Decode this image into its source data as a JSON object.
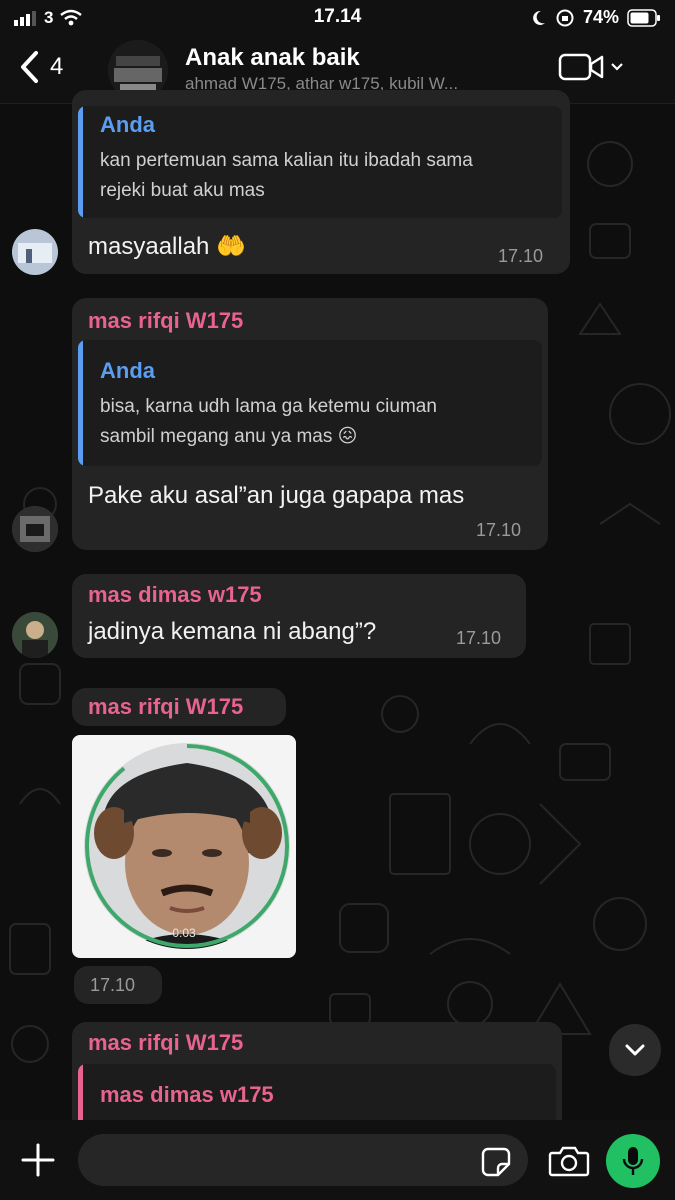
{
  "status_bar": {
    "carrier": "3",
    "time": "17.14",
    "battery": "74%"
  },
  "header": {
    "back_count": "4",
    "group_name": "Anak anak baik",
    "members": "ahmad W175, athar w175, kubil W..."
  },
  "messages": [
    {
      "reply": {
        "name": "Anda",
        "line1": "kan pertemuan sama kalian itu ibadah sama",
        "line2": "rejeki buat aku mas"
      },
      "text": "masyaallah 🤲",
      "time": "17.10"
    },
    {
      "sender": "mas rifqi W175",
      "reply": {
        "name": "Anda",
        "line1": "bisa, karna udh lama ga ketemu ciuman",
        "line2": "sambil megang anu ya mas 😖"
      },
      "text": "Pake aku asal”an juga gapapa mas",
      "time": "17.10"
    },
    {
      "sender": "mas dimas w175",
      "text": "jadinya kemana ni abang”?",
      "time": "17.10"
    },
    {
      "sender": "mas rifqi W175",
      "video_duration": "0:03",
      "time": "17.10"
    },
    {
      "sender": "mas rifqi W175",
      "reply": {
        "name": "mas dimas w175"
      }
    }
  ],
  "colors": {
    "sender_pink": "#e8638d",
    "self_blue": "#5b9df0",
    "accent_green": "#21c063",
    "bubble": "#242424"
  }
}
